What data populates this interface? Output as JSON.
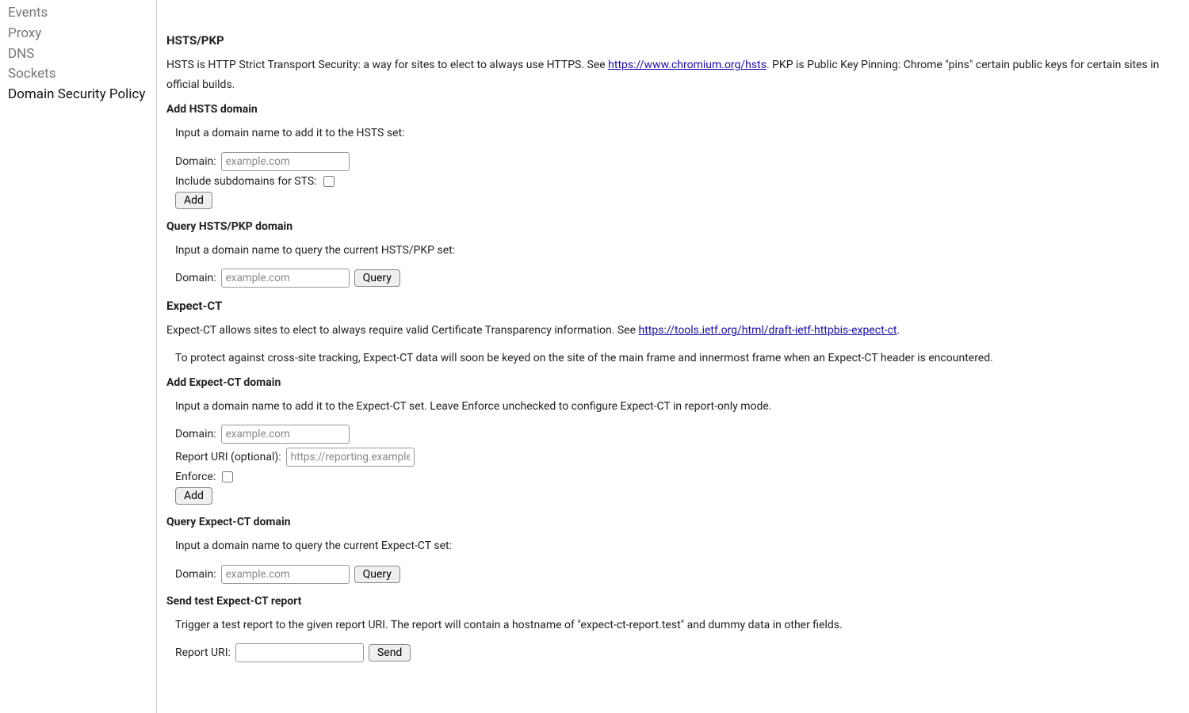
{
  "sidebar": {
    "items": [
      {
        "label": "Events",
        "active": false
      },
      {
        "label": "Proxy",
        "active": false
      },
      {
        "label": "DNS",
        "active": false
      },
      {
        "label": "Sockets",
        "active": false
      },
      {
        "label": "Domain Security Policy",
        "active": true
      }
    ]
  },
  "hsts": {
    "heading": "HSTS/PKP",
    "description_pre": "HSTS is HTTP Strict Transport Security: a way for sites to elect to always use HTTPS. See ",
    "description_link": "https://www.chromium.org/hsts",
    "description_post": ". PKP is Public Key Pinning: Chrome \"pins\" certain public keys for certain sites in official builds.",
    "add": {
      "heading": "Add HSTS domain",
      "help": "Input a domain name to add it to the HSTS set:",
      "domain_label": "Domain:",
      "domain_placeholder": "example.com",
      "include_subdomains_label": "Include subdomains for STS:",
      "button": "Add"
    },
    "query": {
      "heading": "Query HSTS/PKP domain",
      "help": "Input a domain name to query the current HSTS/PKP set:",
      "domain_label": "Domain:",
      "domain_placeholder": "example.com",
      "button": "Query"
    }
  },
  "expectct": {
    "heading": "Expect-CT",
    "description_pre": "Expect-CT allows sites to elect to always require valid Certificate Transparency information. See ",
    "description_link": "https://tools.ietf.org/html/draft-ietf-httpbis-expect-ct",
    "description_post": ".",
    "note": "To protect against cross-site tracking, Expect-CT data will soon be keyed on the site of the main frame and innermost frame when an Expect-CT header is encountered.",
    "add": {
      "heading": "Add Expect-CT domain",
      "help": "Input a domain name to add it to the Expect-CT set. Leave Enforce unchecked to configure Expect-CT in report-only mode.",
      "domain_label": "Domain:",
      "domain_placeholder": "example.com",
      "report_uri_label": "Report URI (optional):",
      "report_uri_placeholder": "https://reporting.example",
      "enforce_label": "Enforce:",
      "button": "Add"
    },
    "query": {
      "heading": "Query Expect-CT domain",
      "help": "Input a domain name to query the current Expect-CT set:",
      "domain_label": "Domain:",
      "domain_placeholder": "example.com",
      "button": "Query"
    },
    "sendtest": {
      "heading": "Send test Expect-CT report",
      "help": "Trigger a test report to the given report URI. The report will contain a hostname of \"expect-ct-report.test\" and dummy data in other fields.",
      "report_uri_label": "Report URI:",
      "button": "Send"
    }
  }
}
